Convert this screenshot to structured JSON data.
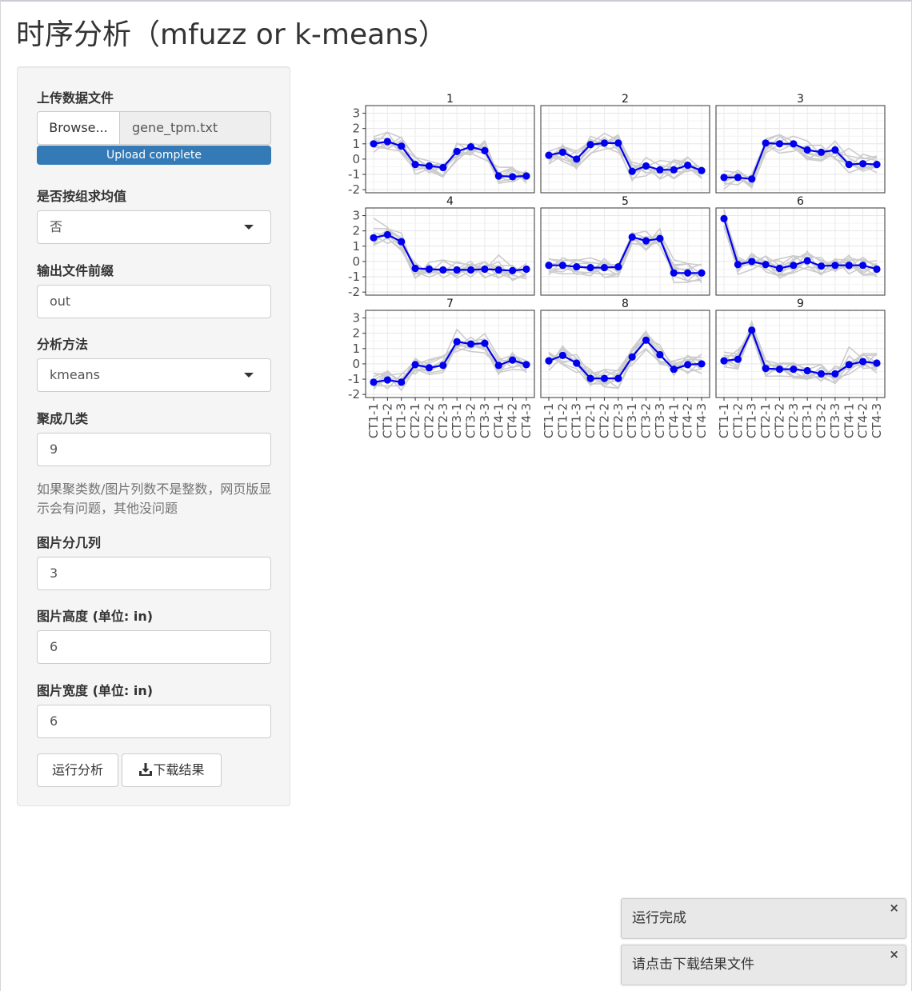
{
  "page": {
    "title": "时序分析（mfuzz or k-means）"
  },
  "sidebar": {
    "upload": {
      "label": "上传数据文件",
      "browse_label": "Browse...",
      "file_name": "gene_tpm.txt",
      "progress_text": "Upload complete",
      "progress": 1.0
    },
    "group_mean": {
      "label": "是否按组求均值",
      "value": "否"
    },
    "prefix": {
      "label": "输出文件前缀",
      "value": "out"
    },
    "method": {
      "label": "分析方法",
      "value": "kmeans"
    },
    "clusters": {
      "label": "聚成几类",
      "value": "9"
    },
    "help_text": "如果聚类数/图片列数不是整数，网页版显示会有问题，其他没问题",
    "columns": {
      "label": "图片分几列",
      "value": "3"
    },
    "height": {
      "label": "图片高度 (单位: in)",
      "value": "6"
    },
    "width": {
      "label": "图片宽度 (单位: in)",
      "value": "6"
    },
    "run_label": "运行分析",
    "download_label": "下载结果",
    "download_icon": "download-icon"
  },
  "chart_data": {
    "type": "line",
    "facet_columns": 3,
    "x": [
      "CT1-1",
      "CT1-2",
      "CT1-3",
      "CT2-1",
      "CT2-2",
      "CT2-3",
      "CT3-1",
      "CT3-2",
      "CT3-3",
      "CT4-1",
      "CT4-2",
      "CT4-3"
    ],
    "ylim": [
      -2.2,
      3.5
    ],
    "yticks": [
      -2,
      -1,
      0,
      1,
      2,
      3
    ],
    "grid": true,
    "member_color": "#cccccc",
    "centroid_color": "#0000ee",
    "panels": [
      {
        "title": "1",
        "centroid": [
          1.0,
          1.15,
          0.85,
          -0.35,
          -0.45,
          -0.55,
          0.5,
          0.8,
          0.55,
          -1.1,
          -1.15,
          -1.1
        ]
      },
      {
        "title": "2",
        "centroid": [
          0.25,
          0.45,
          0.0,
          0.95,
          1.05,
          1.05,
          -0.8,
          -0.45,
          -0.7,
          -0.7,
          -0.4,
          -0.75
        ]
      },
      {
        "title": "3",
        "centroid": [
          -1.2,
          -1.2,
          -1.3,
          1.05,
          1.0,
          1.0,
          0.6,
          0.45,
          0.6,
          -0.35,
          -0.3,
          -0.35
        ]
      },
      {
        "title": "4",
        "centroid": [
          1.55,
          1.75,
          1.3,
          -0.45,
          -0.5,
          -0.55,
          -0.55,
          -0.55,
          -0.5,
          -0.55,
          -0.6,
          -0.5
        ]
      },
      {
        "title": "5",
        "centroid": [
          -0.25,
          -0.25,
          -0.35,
          -0.4,
          -0.4,
          -0.35,
          1.6,
          1.35,
          1.5,
          -0.75,
          -0.75,
          -0.75
        ]
      },
      {
        "title": "6",
        "centroid": [
          2.8,
          -0.2,
          0.0,
          -0.2,
          -0.45,
          -0.25,
          0.05,
          -0.3,
          -0.25,
          -0.25,
          -0.25,
          -0.5
        ]
      },
      {
        "title": "7",
        "centroid": [
          -1.2,
          -1.05,
          -1.2,
          -0.05,
          -0.25,
          -0.1,
          1.45,
          1.3,
          1.35,
          -0.1,
          0.25,
          -0.05
        ]
      },
      {
        "title": "8",
        "centroid": [
          0.2,
          0.55,
          0.05,
          -0.95,
          -0.95,
          -0.95,
          0.45,
          1.55,
          0.6,
          -0.35,
          -0.05,
          0.0
        ]
      },
      {
        "title": "9",
        "centroid": [
          0.2,
          0.3,
          2.2,
          -0.3,
          -0.35,
          -0.35,
          -0.45,
          -0.65,
          -0.65,
          -0.05,
          0.15,
          0.05
        ]
      }
    ]
  },
  "notifications": [
    {
      "text": "运行完成",
      "close": "×"
    },
    {
      "text": "请点击下载结果文件",
      "close": "×"
    }
  ]
}
